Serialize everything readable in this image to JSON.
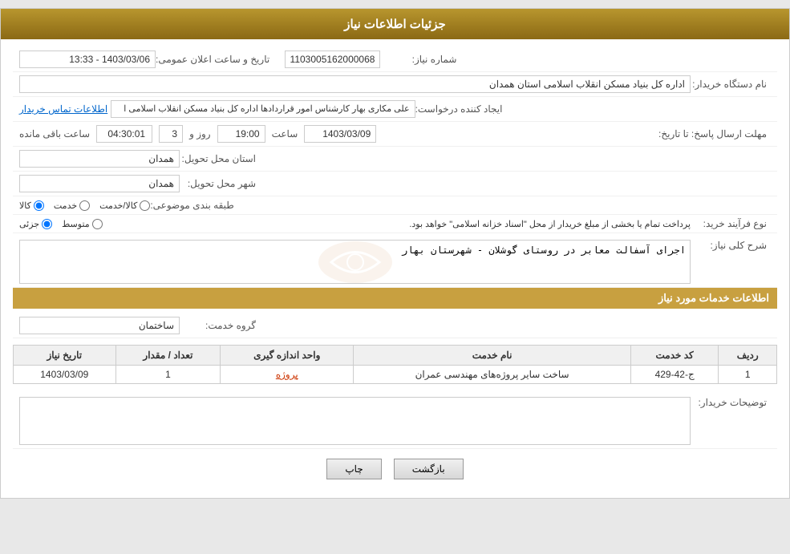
{
  "header": {
    "title": "جزئیات اطلاعات نیاز"
  },
  "fields": {
    "need_number_label": "شماره نیاز:",
    "need_number_value": "1103005162000068",
    "announce_date_label": "تاریخ و ساعت اعلان عمومی:",
    "announce_date_value": "1403/03/06 - 13:33",
    "buyer_org_label": "نام دستگاه خریدار:",
    "buyer_org_value": "اداره کل بنیاد مسکن انقلاب اسلامی استان همدان",
    "creator_label": "ایجاد کننده درخواست:",
    "creator_value": "علی مکاری بهار کارشناس امور قراردادها اداره کل بنیاد مسکن انقلاب اسلامی ا",
    "creator_link": "اطلاعات تماس خریدار",
    "deadline_label": "مهلت ارسال پاسخ: تا تاریخ:",
    "deadline_date": "1403/03/09",
    "deadline_time_label": "ساعت",
    "deadline_time": "19:00",
    "deadline_days_label": "روز و",
    "deadline_days": "3",
    "deadline_remain_label": "ساعت باقی مانده",
    "deadline_remain": "04:30:01",
    "province_label": "استان محل تحویل:",
    "province_value": "همدان",
    "city_label": "شهر محل تحویل:",
    "city_value": "همدان",
    "category_label": "طبقه بندی موضوعی:",
    "category_radio": [
      "کالا",
      "خدمت",
      "کالا/خدمت"
    ],
    "category_selected": "کالا",
    "purchase_type_label": "نوع فرآیند خرید:",
    "purchase_radio": [
      "جزئی",
      "متوسط"
    ],
    "purchase_note": "پرداخت تمام یا بخشی از مبلغ خریدار از محل \"اسناد خزانه اسلامی\" خواهد بود.",
    "general_desc_label": "شرح کلی نیاز:",
    "general_desc_value": "اجرای آسفالت معابر در روستای گوشلان - شهرستان بهار",
    "services_title": "اطلاعات خدمات مورد نیاز",
    "service_group_label": "گروه خدمت:",
    "service_group_value": "ساختمان",
    "table_headers": [
      "ردیف",
      "کد خدمت",
      "نام خدمت",
      "واحد اندازه گیری",
      "تعداد / مقدار",
      "تاریخ نیاز"
    ],
    "table_rows": [
      {
        "row": "1",
        "code": "ج-42-429",
        "name": "ساخت سایر پروژه‌های مهندسی عمران",
        "unit": "پروژه",
        "qty": "1",
        "date": "1403/03/09"
      }
    ],
    "buyer_desc_label": "توضیحات خریدار:",
    "buyer_desc_value": ""
  },
  "buttons": {
    "print": "چاپ",
    "back": "بازگشت"
  }
}
